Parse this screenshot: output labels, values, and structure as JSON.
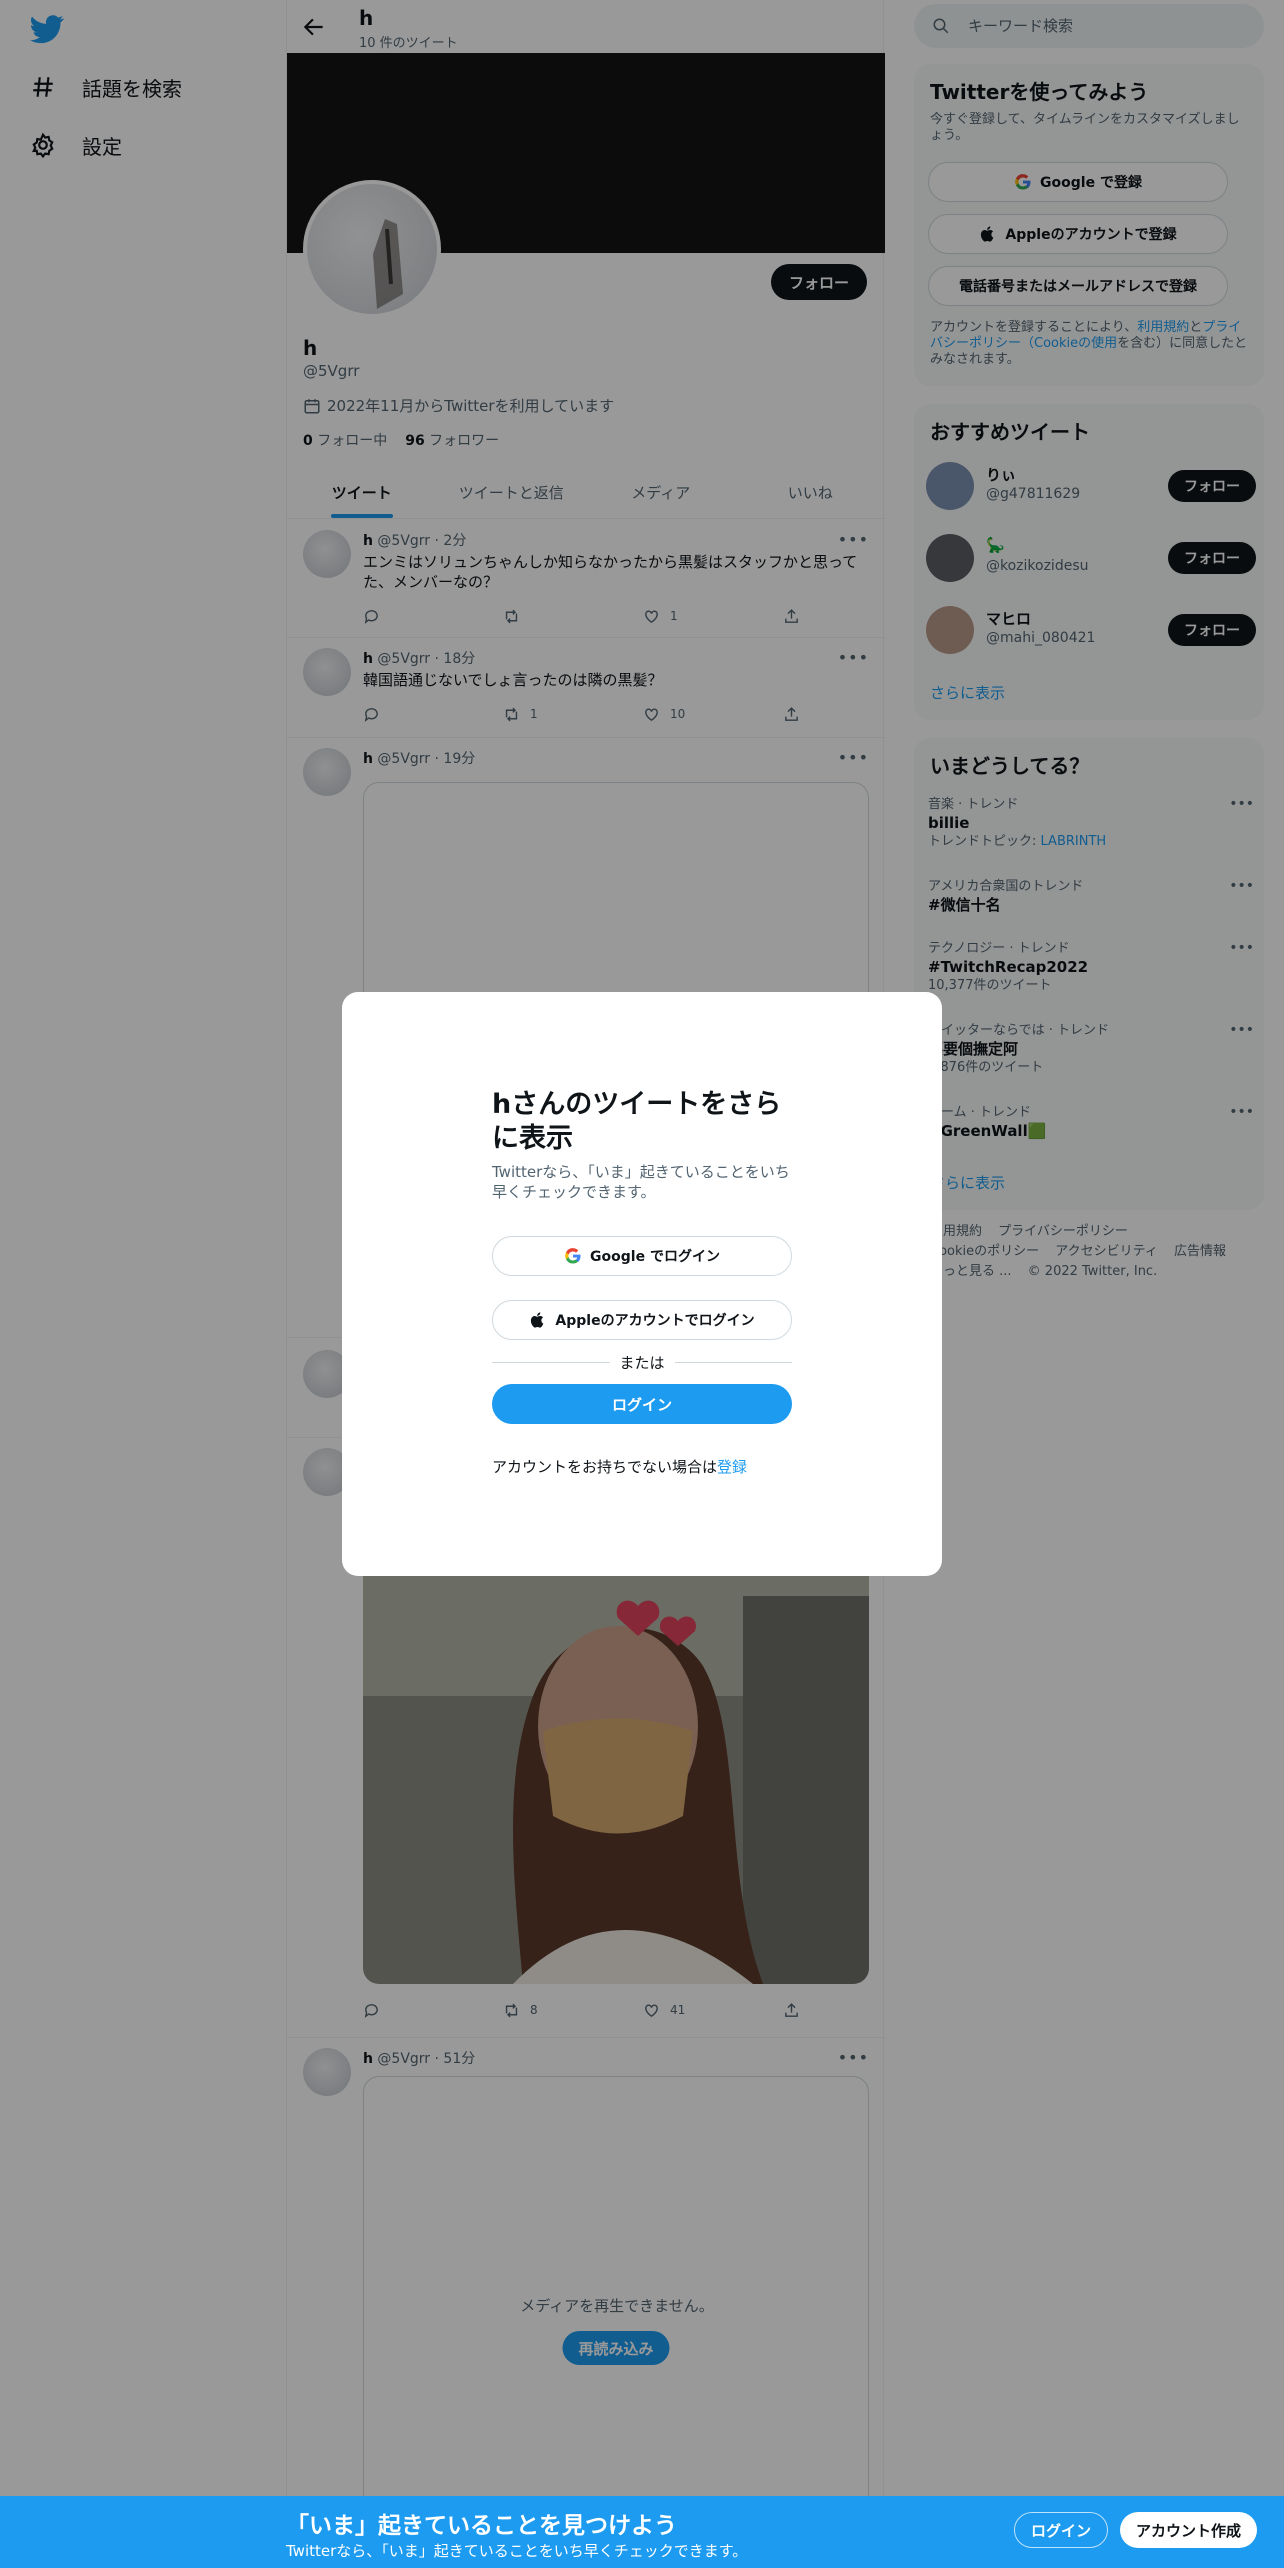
{
  "nav": {
    "items": [
      {
        "label": "話題を検索",
        "icon": "hashtag-icon"
      },
      {
        "label": "設定",
        "icon": "gear-icon"
      }
    ]
  },
  "profile": {
    "header_name": "h",
    "tweet_count": "10 件のツイート",
    "name": "h",
    "handle": "@5Vgrr",
    "joined": "2022年11月からTwitterを利用しています",
    "following_count": "0",
    "following_label": "フォロー中",
    "followers_count": "96",
    "followers_label": "フォロワー",
    "follow_button": "フォロー"
  },
  "tabs": [
    "ツイート",
    "ツイートと返信",
    "メディア",
    "いいね"
  ],
  "tweets": [
    {
      "name": "h",
      "meta": "@5Vgrr · 2分",
      "text": "エンミはソリュンちゃんしか知らなかったから黒髪はスタッフかと思ってた、メンバーなの？",
      "reply": "",
      "retweet": "",
      "like": "1"
    },
    {
      "name": "h",
      "meta": "@5Vgrr · 18分",
      "text": "韓国語通じないでしょ言ったのは隣の黒髪？",
      "reply": "",
      "retweet": "1",
      "like": "10"
    },
    {
      "name": "h",
      "meta": "@5Vgrr · 19分",
      "text": "",
      "reply": "",
      "retweet": "",
      "like": ""
    },
    {
      "name": "",
      "meta": "",
      "text": "",
      "reply": "",
      "retweet": "",
      "like": ""
    },
    {
      "name": "",
      "meta": "",
      "text": "",
      "reply": "",
      "retweet": "8",
      "like": "41"
    },
    {
      "name": "h",
      "meta": "@5Vgrr · 51分",
      "text": "",
      "reply": "",
      "retweet": "",
      "like": ""
    }
  ],
  "media": {
    "unplayable": "メディアを再生できません。",
    "reload": "再読み込み"
  },
  "sidebar": {
    "search_placeholder": "キーワード検索",
    "signup_card": {
      "title": "Twitterを使ってみよう",
      "desc": "今すぐ登録して、タイムラインをカスタマイズしましょう。",
      "google": "Google で登録",
      "apple": "Appleのアカウントで登録",
      "phone": "電話番号またはメールアドレスで登録",
      "terms_prefix": "アカウントを登録することにより、",
      "terms_link1": "利用規約",
      "terms_mid": "と",
      "terms_link2": "プライバシーポリシー（Cookieの使用",
      "terms_suffix": "を含む）に同意したとみなされます。"
    },
    "recommend": {
      "title": "おすすめツイート",
      "users": [
        {
          "name": "りぃ",
          "handle": "@g47811629",
          "follow": "フォロー",
          "color": "#7c8fb0"
        },
        {
          "name": "🦕",
          "handle": "@kozikozidesu",
          "follow": "フォロー",
          "color": "#5b5e63"
        },
        {
          "name": "マヒロ",
          "handle": "@mahi_080421",
          "follow": "フォロー",
          "color": "#b79a8a"
        }
      ],
      "show_more": "さらに表示"
    },
    "trends": {
      "title": "いまどうしてる？",
      "items": [
        {
          "meta": "音楽 · トレンド",
          "name": "billie",
          "sub_prefix": "トレンドトピック: ",
          "sub_link": "LABRINTH",
          "sub": ""
        },
        {
          "meta": "アメリカ合衆国のトレンド",
          "name": "#微信十名",
          "sub_prefix": "",
          "sub_link": "",
          "sub": ""
        },
        {
          "meta": "テクノロジー · トレンド",
          "name": "#TwitchRecap2022",
          "sub_prefix": "",
          "sub_link": "",
          "sub": "10,377件のツイート"
        },
        {
          "meta": "ツイッターならでは · トレンド",
          "name": "要要個撫定阿",
          "sub_prefix": "",
          "sub_link": "",
          "sub": "5,876件のツイート"
        },
        {
          "meta": "ゲーム · トレンド",
          "name": "#GreenWall🟩",
          "sub_prefix": "",
          "sub_link": "",
          "sub": ""
        }
      ],
      "show_more": "さらに表示"
    },
    "footer": [
      "利用規約",
      "プライバシーポリシー",
      "Cookieのポリシー",
      "アクセシビリティ",
      "広告情報",
      "もっと見る ...",
      "© 2022 Twitter, Inc."
    ]
  },
  "modal": {
    "title": "hさんのツイートをさらに表示",
    "desc": "Twitterなら、「いま」起きていることをいち早くチェックできます。",
    "google": "Google でログイン",
    "apple": "Appleのアカウントでログイン",
    "or": "または",
    "login": "ログイン",
    "no_account": "アカウントをお持ちでない場合は",
    "signup_link": "登録"
  },
  "bottombar": {
    "title": "「いま」起きていることを見つけよう",
    "sub": "Twitterなら、「いま」起きていることをいち早くチェックできます。",
    "login": "ログイン",
    "signup": "アカウント作成"
  },
  "colors": {
    "accent": "#1d9bf0",
    "dark": "#0f1419",
    "muted": "#536471"
  }
}
